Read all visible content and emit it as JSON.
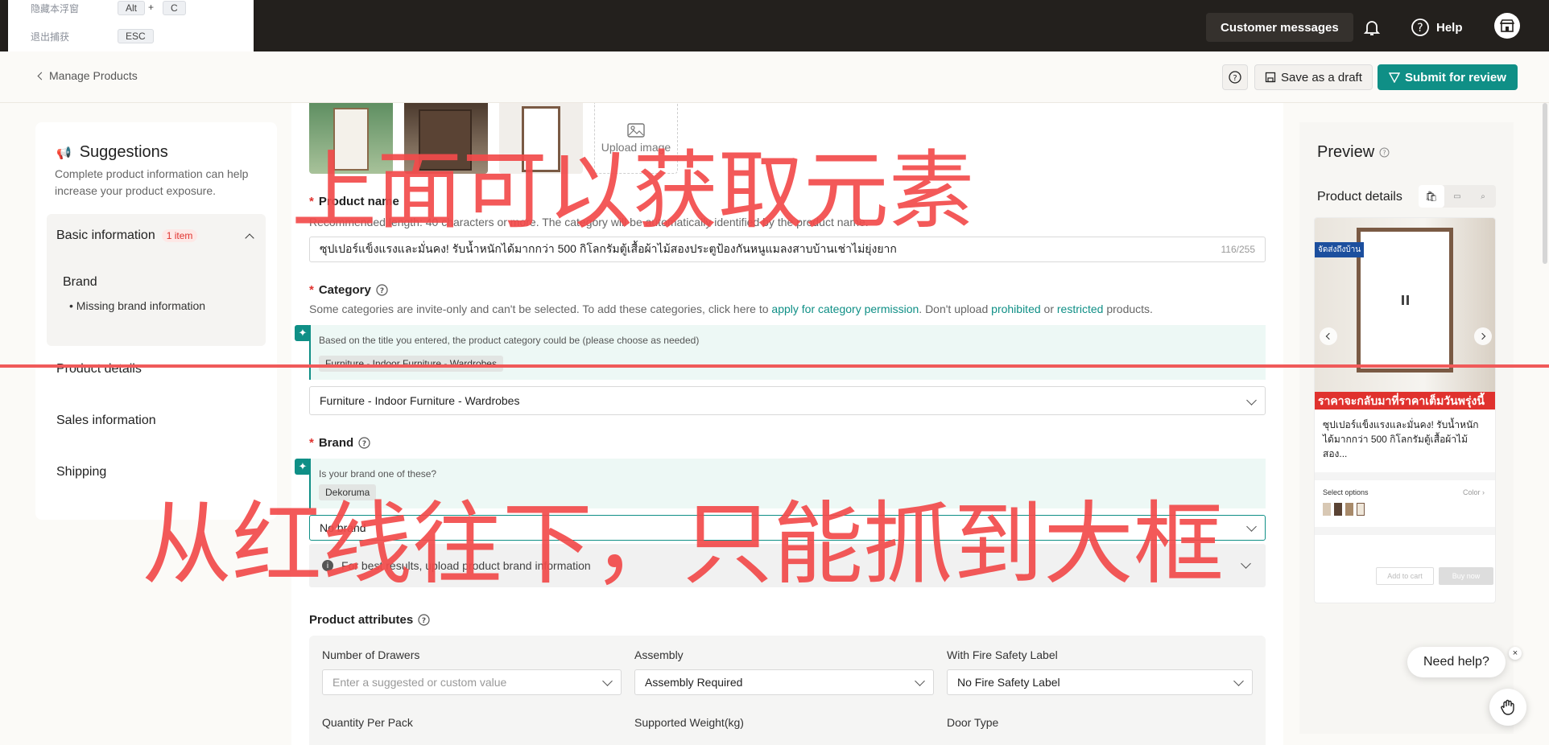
{
  "capture_popup": {
    "row1_label": "隐藏本浮窗",
    "row1_key1": "Alt",
    "row1_plus": "+",
    "row1_key2": "C",
    "row2_label": "退出捕获",
    "row2_key": "ESC"
  },
  "topbar": {
    "customer_messages": "Customer messages",
    "help": "Help"
  },
  "subheader": {
    "back_label": "Manage Products",
    "save_draft": "Save as a draft",
    "submit": "Submit for review"
  },
  "suggestions": {
    "title": "Suggestions",
    "desc_line1": "Complete product information can help",
    "desc_line2": "increase your product exposure.",
    "basic_info": "Basic information",
    "basic_count": "1 item",
    "brand": "Brand",
    "missing_brand": "Missing brand information",
    "nav": [
      "Product details",
      "Sales information",
      "Shipping"
    ]
  },
  "product": {
    "upload_label": "Upload image",
    "name_label": "Product name",
    "name_hint": "Recommended length: 40 characters or more. The category will be automatically identified by the product name.",
    "name_value": "ซุปเปอร์แข็งแรงและมั่นคง! รับน้ำหนักได้มากกว่า 500 กิโลกรัมตู้เสื้อผ้าไม้สองประตูป้องกันหนูแมลงสาบบ้านเช่าไม่ยุ่งยาก",
    "name_count": "116/255",
    "category_label": "Category",
    "category_hint_pre": "Some categories are invite-only and can't be selected. To add these categories, click here to ",
    "category_link1": "apply for category permission",
    "category_hint_mid": ". Don't upload ",
    "category_link2": "prohibited",
    "category_hint_or": " or ",
    "category_link3": "restricted",
    "category_hint_post": " products.",
    "category_ai_hint": "Based on the title you entered, the product category could be (please choose as needed)",
    "category_chip": "Furniture - Indoor Furniture - Wardrobes",
    "category_value": "Furniture - Indoor Furniture - Wardrobes",
    "brand_label": "Brand",
    "brand_ai_hint": "Is your brand one of these?",
    "brand_chip": "Dekoruma",
    "brand_value": "No brand",
    "brand_info": "For best results, upload product brand information",
    "attributes_label": "Product attributes",
    "attributes": [
      {
        "label": "Number of Drawers",
        "value": "",
        "placeholder": "Enter a suggested or custom value"
      },
      {
        "label": "Assembly",
        "value": "Assembly Required"
      },
      {
        "label": "With Fire Safety Label",
        "value": "No Fire Safety Label"
      },
      {
        "label": "Quantity Per Pack"
      },
      {
        "label": "Supported Weight(kg)"
      },
      {
        "label": "Door Type"
      }
    ]
  },
  "preview": {
    "title": "Preview",
    "product_details": "Product details",
    "promo_tag": "จัดส่งถึงบ้าน",
    "banner": "ราคาจะกลับมาที่ราคาเต็มวันพรุ่งนี้",
    "product_title": "ซุปเปอร์แข็งแรงและมั่นคง! รับน้ำหนักได้มากกว่า 500 กิโลกรัมตู้เสื้อผ้าไม้สอง...",
    "select_options": "Select options",
    "color": "Color",
    "add_to_cart": "Add to cart",
    "buy_now": "Buy now"
  },
  "need_help": "Need help?",
  "overlay": {
    "top_text": "上面可以获取元素",
    "bottom_text": "从红线往下，只能抓到大框"
  },
  "colors": {
    "accent": "#0f8f86",
    "overlay_red": "#f24b4b",
    "topbar": "#23201d"
  }
}
